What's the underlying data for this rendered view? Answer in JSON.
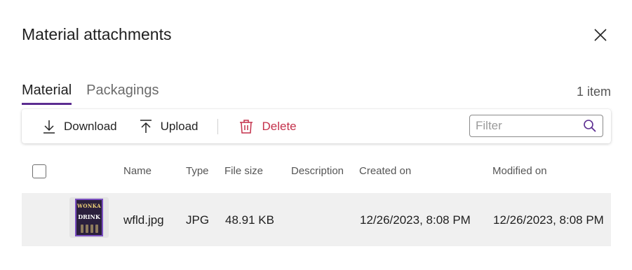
{
  "dialog": {
    "title": "Material attachments"
  },
  "tabs": [
    {
      "label": "Material",
      "active": true
    },
    {
      "label": "Packagings",
      "active": false
    }
  ],
  "item_count": "1 item",
  "toolbar": {
    "download_label": "Download",
    "upload_label": "Upload",
    "delete_label": "Delete",
    "filter_placeholder": "Filter"
  },
  "table": {
    "columns": [
      "Name",
      "Type",
      "File size",
      "Description",
      "Created on",
      "Modified on"
    ],
    "rows": [
      {
        "thumbnail_text_top": "WONKA",
        "thumbnail_text_main": "DRINK",
        "name": "wfld.jpg",
        "type": "JPG",
        "file_size": "48.91 KB",
        "description": "",
        "created_on": "12/26/2023, 8:08 PM",
        "modified_on": "12/26/2023, 8:08 PM"
      }
    ]
  },
  "colors": {
    "accent": "#5c2d91",
    "delete": "#c4314b",
    "row_bg": "#f0f0f0"
  }
}
